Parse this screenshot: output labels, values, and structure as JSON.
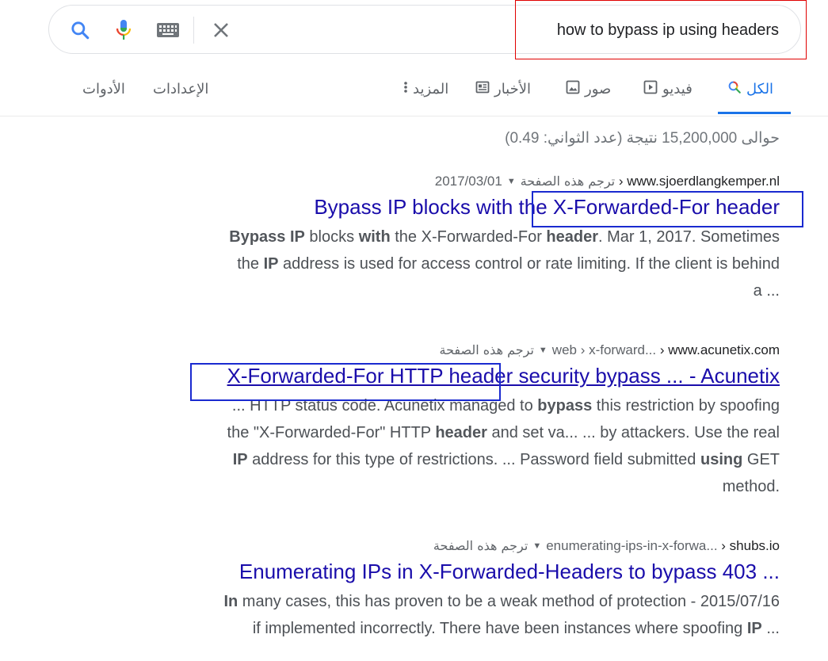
{
  "search": {
    "query": "how to bypass ip using headers"
  },
  "tabs": {
    "all": "الكل",
    "video": "فيديو",
    "images": "صور",
    "news": "الأخبار",
    "more": "المزيد",
    "settings": "الإعدادات",
    "tools": "الأدوات"
  },
  "result_stats": "حوالى 15,200,000 نتيجة (عدد الثواني: 0.49)",
  "results": [
    {
      "domain": "www.sjoerdlangkemper.nl",
      "path": "",
      "date": "2017/03/01",
      "translate": "ترجم هذه الصفحة",
      "title": "Bypass IP blocks with the X-Forwarded-For header",
      "snippet_lines": [
        "<b>Bypass IP</b> blocks <b>with</b> the X-Forwarded-For <b>header</b>. Mar 1, 2017. Sometimes",
        "the <b>IP</b> address is used for access control or rate limiting. If the client is behind",
        "a ..."
      ]
    },
    {
      "domain": "www.acunetix.com",
      "path": "web › x-forward...",
      "date": "",
      "translate": "ترجم هذه الصفحة",
      "title": "X-Forwarded-For HTTP header security bypass ... - Acunetix",
      "snippet_lines": [
        "... HTTP status code. Acunetix managed to <b>bypass</b> this restriction by spoofing",
        "the \"X-Forwarded-For\" HTTP <b>header</b> and set va... ... by attackers. Use the real",
        "<b>IP</b> address for this type of restrictions. ... Password field submitted <b>using</b> GET",
        "method."
      ]
    },
    {
      "domain": "shubs.io",
      "path": "enumerating-ips-in-x-forwa...",
      "date": "",
      "translate": "ترجم هذه الصفحة",
      "title": "Enumerating IPs in X-Forwarded-Headers to bypass 403 ...",
      "snippet_lines": [
        "<b>In</b> many cases, this has proven to be a weak method of protection - 2015/07/16",
        "if implemented incorrectly. There have been instances where spoofing <b>IP</b> ..."
      ]
    }
  ],
  "colors": {
    "link": "#1a0dab",
    "accent": "#1a73e8",
    "annotation_red": "#e00000",
    "annotation_blue": "#1a2ad0"
  }
}
